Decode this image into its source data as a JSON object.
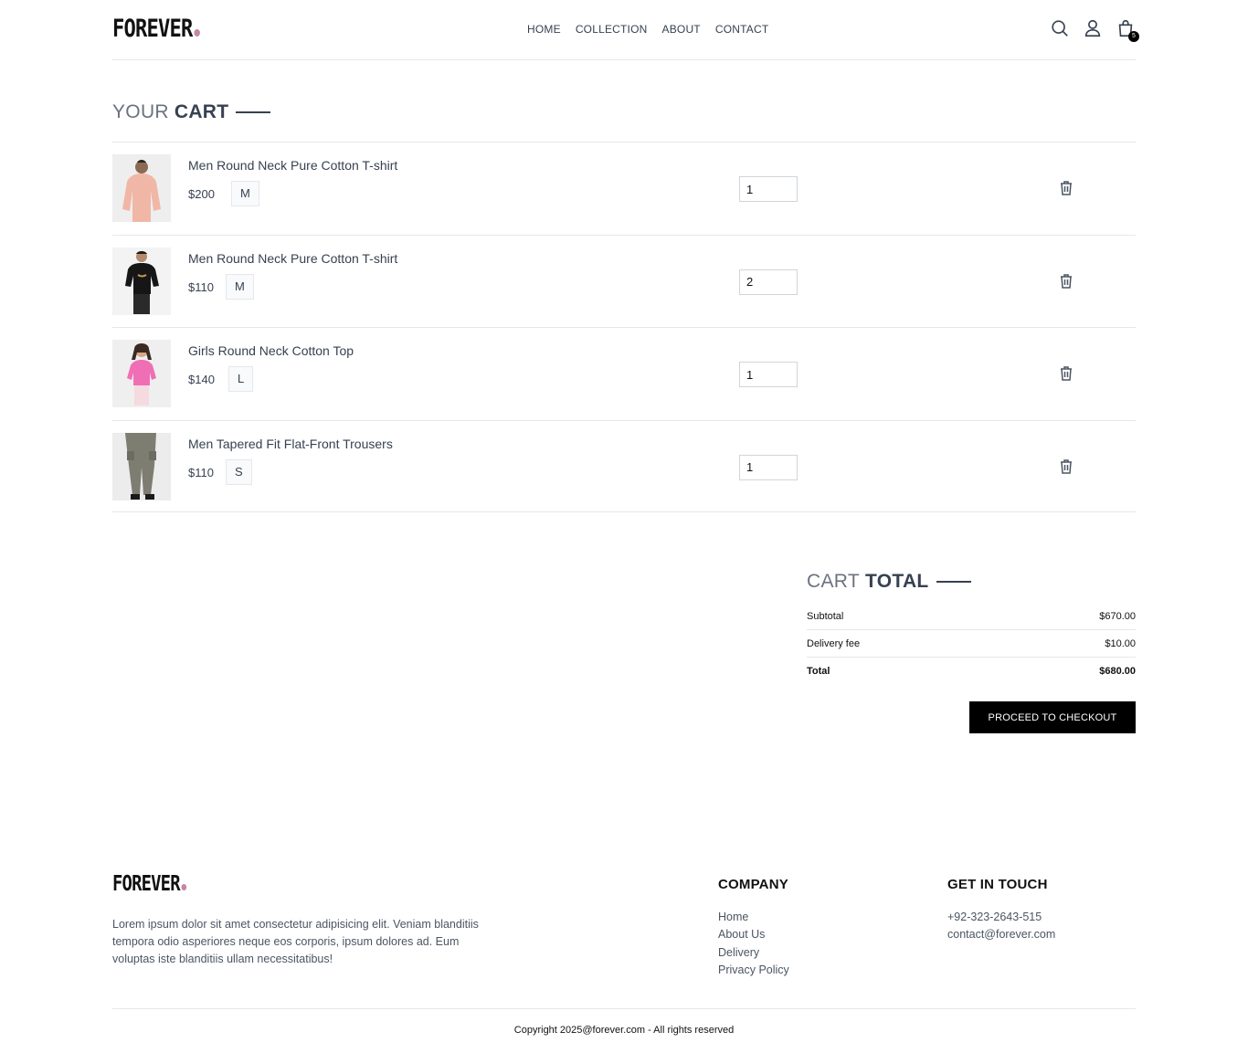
{
  "header": {
    "logo": "FOREVER",
    "nav": [
      "HOME",
      "COLLECTION",
      "ABOUT",
      "CONTACT"
    ],
    "cart_count": "5",
    "icons": [
      "search-icon",
      "user-icon",
      "shopping-bag-icon"
    ]
  },
  "cart": {
    "title_light": "YOUR",
    "title_bold": "CART",
    "items": [
      {
        "name": "Men Round Neck Pure Cotton T-shirt",
        "price": "$200",
        "size": "M",
        "quantity": "1"
      },
      {
        "name": "Men Round Neck Pure Cotton T-shirt",
        "price": "$110",
        "size": "M",
        "quantity": "2"
      },
      {
        "name": "Girls Round Neck Cotton Top",
        "price": "$140",
        "size": "L",
        "quantity": "1"
      },
      {
        "name": "Men Tapered Fit Flat-Front Trousers",
        "price": "$110",
        "size": "S",
        "quantity": "1"
      }
    ]
  },
  "totals": {
    "title_light": "CART",
    "title_bold": "TOTAL",
    "subtotal_label": "Subtotal",
    "subtotal_value": "$670.00",
    "delivery_label": "Delivery fee",
    "delivery_value": "$10.00",
    "total_label": "Total",
    "total_value": "$680.00",
    "checkout_label": "PROCEED TO CHECKOUT"
  },
  "footer": {
    "logo": "FOREVER",
    "description": "Lorem ipsum dolor sit amet consectetur adipisicing elit. Veniam blanditiis tempora odio asperiores neque eos corporis, ipsum dolores ad. Eum voluptas iste blanditiis ullam necessitatibus!",
    "company_title": "COMPANY",
    "company_links": [
      "Home",
      "About Us",
      "Delivery",
      "Privacy Policy"
    ],
    "contact_title": "GET IN TOUCH",
    "phone": "+92-323-2643-515",
    "email": "contact@forever.com",
    "copyright": "Copyright 2025@forever.com - All rights reserved"
  },
  "colors": {
    "accent_dot": "#c586a5",
    "button_bg": "#000000",
    "text": "#374151"
  }
}
